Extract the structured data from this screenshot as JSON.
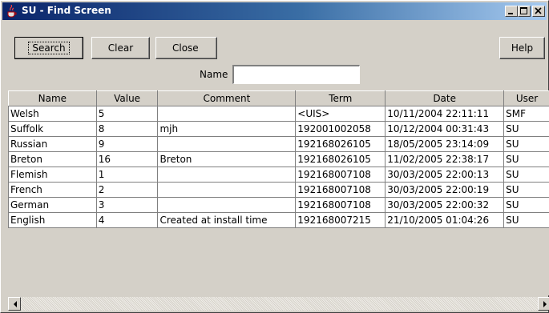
{
  "window": {
    "title": "SU - Find Screen",
    "icon": "java-cup-icon"
  },
  "titlebar_buttons": {
    "minimize": "minimize-icon",
    "maximize": "maximize-icon",
    "close": "close-icon"
  },
  "toolbar": {
    "search_label": "Search",
    "clear_label": "Clear",
    "close_label": "Close",
    "help_label": "Help"
  },
  "filter": {
    "name_label": "Name",
    "name_value": ""
  },
  "table": {
    "columns": [
      "Name",
      "Value",
      "Comment",
      "Term",
      "Date",
      "User"
    ],
    "rows": [
      [
        "Welsh",
        "5",
        "",
        "<UIS>",
        "10/11/2004 22:11:11",
        "SMF"
      ],
      [
        "Suffolk",
        "8",
        "mjh",
        "192001002058",
        "10/12/2004 00:31:43",
        "SU"
      ],
      [
        "Russian",
        "9",
        "",
        "192168026105",
        "18/05/2005 23:14:09",
        "SU"
      ],
      [
        "Breton",
        "16",
        "Breton",
        "192168026105",
        "11/02/2005 22:38:17",
        "SU"
      ],
      [
        "Flemish",
        "1",
        "",
        "192168007108",
        "30/03/2005 22:00:13",
        "SU"
      ],
      [
        "French",
        "2",
        "",
        "192168007108",
        "30/03/2005 22:00:19",
        "SU"
      ],
      [
        "German",
        "3",
        "",
        "192168007108",
        "30/03/2005 22:00:32",
        "SU"
      ],
      [
        "English",
        "4",
        "Created at install time",
        "192168007215",
        "21/10/2005 01:04:26",
        "SU"
      ]
    ]
  },
  "scrollbar": {
    "left_icon": "scroll-left-icon",
    "right_icon": "scroll-right-icon"
  }
}
